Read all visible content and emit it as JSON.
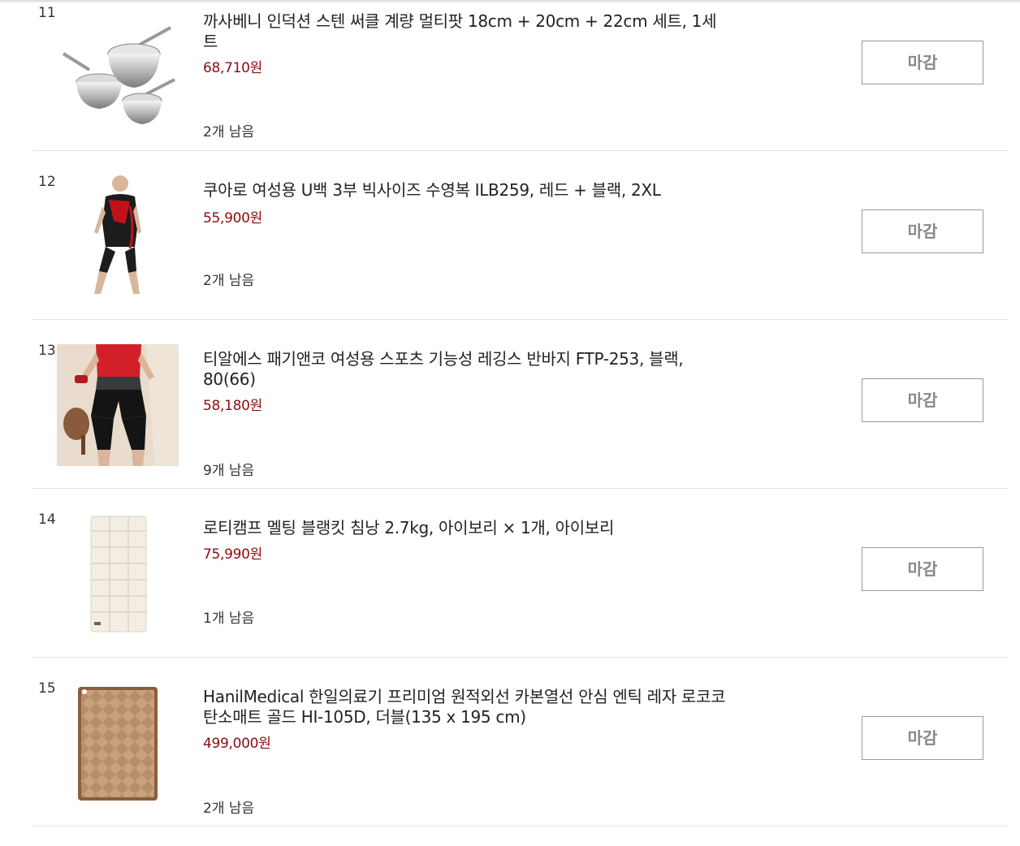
{
  "items": [
    {
      "rank": "11",
      "title": "까사베니 인덕션 스텐 써클 계량 멀티팟 18cm + 20cm + 22cm 세트, 1세트",
      "price": "68,710원",
      "stock": "2개 남음",
      "button": "마감",
      "image_icon": "stainless-pot-set"
    },
    {
      "rank": "12",
      "title": "쿠아로 여성용 U백 3부 빅사이즈 수영복 ILB259, 레드 + 블랙, 2XL",
      "price": "55,900원",
      "stock": "2개 남음",
      "button": "마감",
      "image_icon": "swimsuit"
    },
    {
      "rank": "13",
      "title": "티알에스 패기앤코 여성용 스포츠 기능성 레깅스 반바지 FTP-253, 블랙, 80(66)",
      "price": "58,180원",
      "stock": "9개 남음",
      "button": "마감",
      "image_icon": "sport-leggings"
    },
    {
      "rank": "14",
      "title": "로티캠프 멜팅 블랭킷 침낭 2.7kg, 아이보리 × 1개, 아이보리",
      "price": "75,990원",
      "stock": "1개 남음",
      "button": "마감",
      "image_icon": "sleeping-bag"
    },
    {
      "rank": "15",
      "title": "HanilMedical 한일의료기 프리미엄 원적외선 카본열선 안심 엔틱 레자 로코코 탄소매트 골드 HI-105D, 더블(135 x 195 cm)",
      "price": "499,000원",
      "stock": "2개 남음",
      "button": "마감",
      "image_icon": "carbon-mat"
    }
  ],
  "colors": {
    "price": "#8b0d12",
    "button_text": "#888888",
    "divider": "#e3e3e3"
  }
}
